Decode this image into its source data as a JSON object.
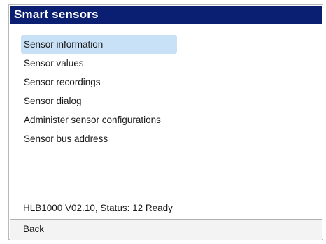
{
  "header": {
    "title": "Smart sensors"
  },
  "menu": {
    "items": [
      {
        "label": "Sensor information",
        "selected": true
      },
      {
        "label": "Sensor values",
        "selected": false
      },
      {
        "label": "Sensor recordings",
        "selected": false
      },
      {
        "label": "Sensor dialog",
        "selected": false
      },
      {
        "label": "Administer sensor configurations",
        "selected": false
      },
      {
        "label": "Sensor bus address",
        "selected": false
      }
    ]
  },
  "status": {
    "text": "HLB1000 V02.10, Status: 12 Ready"
  },
  "footer": {
    "back_label": "Back"
  },
  "colors": {
    "title_bar": "#0a1f71",
    "selected_item": "#c9e1f6"
  }
}
